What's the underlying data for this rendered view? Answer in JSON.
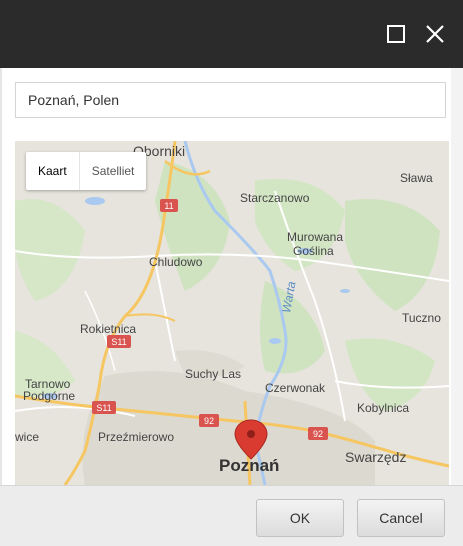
{
  "window": {
    "maximize_icon": "maximize-icon",
    "close_icon": "close-icon"
  },
  "search": {
    "value": "Poznań, Polen"
  },
  "map": {
    "map_type": {
      "options": [
        "Kaart",
        "Satelliet"
      ],
      "selected": "Kaart"
    },
    "places": {
      "oborniki": "Oborniki",
      "slawica": "Sława",
      "starczanowo": "Starczanowo",
      "murowana": "Murowana",
      "goslina": "Goślina",
      "chludowo": "Chludowo",
      "warta": "Warta",
      "rokietnica": "Rokietnica",
      "tuczno": "Tuczno",
      "suchy_las": "Suchy Las",
      "tarnowo": "Tarnowo",
      "podgorne": "Podgórne",
      "czerwonak": "Czerwonak",
      "kobylnica": "Kobylnica",
      "wice": "wice",
      "przezmierowo": "Przeźmierowo",
      "swarzedz": "Swarzędz",
      "poznan": "Poznań"
    },
    "road_shields": {
      "r11": "11",
      "s11a": "S11",
      "s11b": "S11",
      "r92a": "92",
      "r92b": "92"
    },
    "marker_icon": "location-pin-icon"
  },
  "buttons": {
    "ok": "OK",
    "cancel": "Cancel"
  }
}
